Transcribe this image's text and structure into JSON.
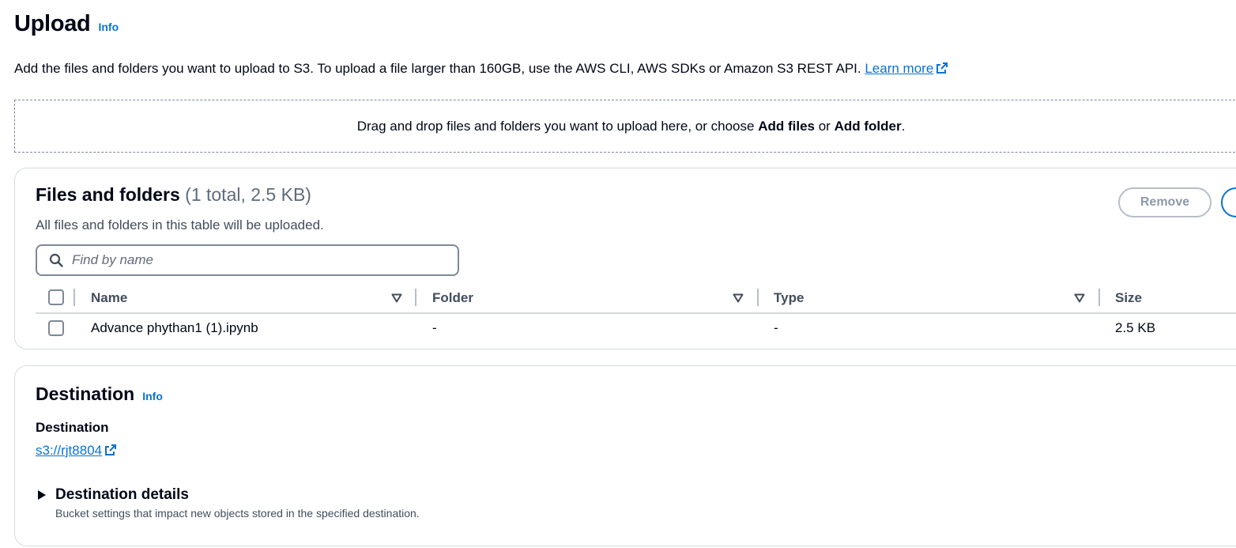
{
  "header": {
    "title": "Upload",
    "info_label": "Info"
  },
  "description": {
    "text": "Add the files and folders you want to upload to S3. To upload a file larger than 160GB, use the AWS CLI, AWS SDKs or Amazon S3 REST API.",
    "learn_more": "Learn more"
  },
  "dropzone": {
    "prefix": "Drag and drop files and folders you want to upload here, or choose",
    "add_files": "Add files",
    "or": "or",
    "add_folder": "Add folder",
    "suffix": "."
  },
  "files_panel": {
    "title": "Files and folders",
    "count": "(1 total, 2.5 KB)",
    "description": "All files and folders in this table will be uploaded.",
    "remove_label": "Remove",
    "search_placeholder": "Find by name",
    "columns": [
      "Name",
      "Folder",
      "Type",
      "Size"
    ],
    "rows": [
      {
        "name": "Advance phythan1 (1).ipynb",
        "folder": "-",
        "type": "-",
        "size": "2.5 KB"
      }
    ]
  },
  "destination_panel": {
    "title": "Destination",
    "info_label": "Info",
    "label": "Destination",
    "link": "s3://rjt8804",
    "details_title": "Destination details",
    "details_description": "Bucket settings that impact new objects stored in the specified destination."
  },
  "colors": {
    "link": "#0972d3",
    "text": "#000716",
    "muted": "#5f6b7a",
    "border": "#d5dbdb"
  },
  "icons": [
    "info-link",
    "external-link-icon",
    "search-icon",
    "sort-icon",
    "caret-right-icon"
  ]
}
